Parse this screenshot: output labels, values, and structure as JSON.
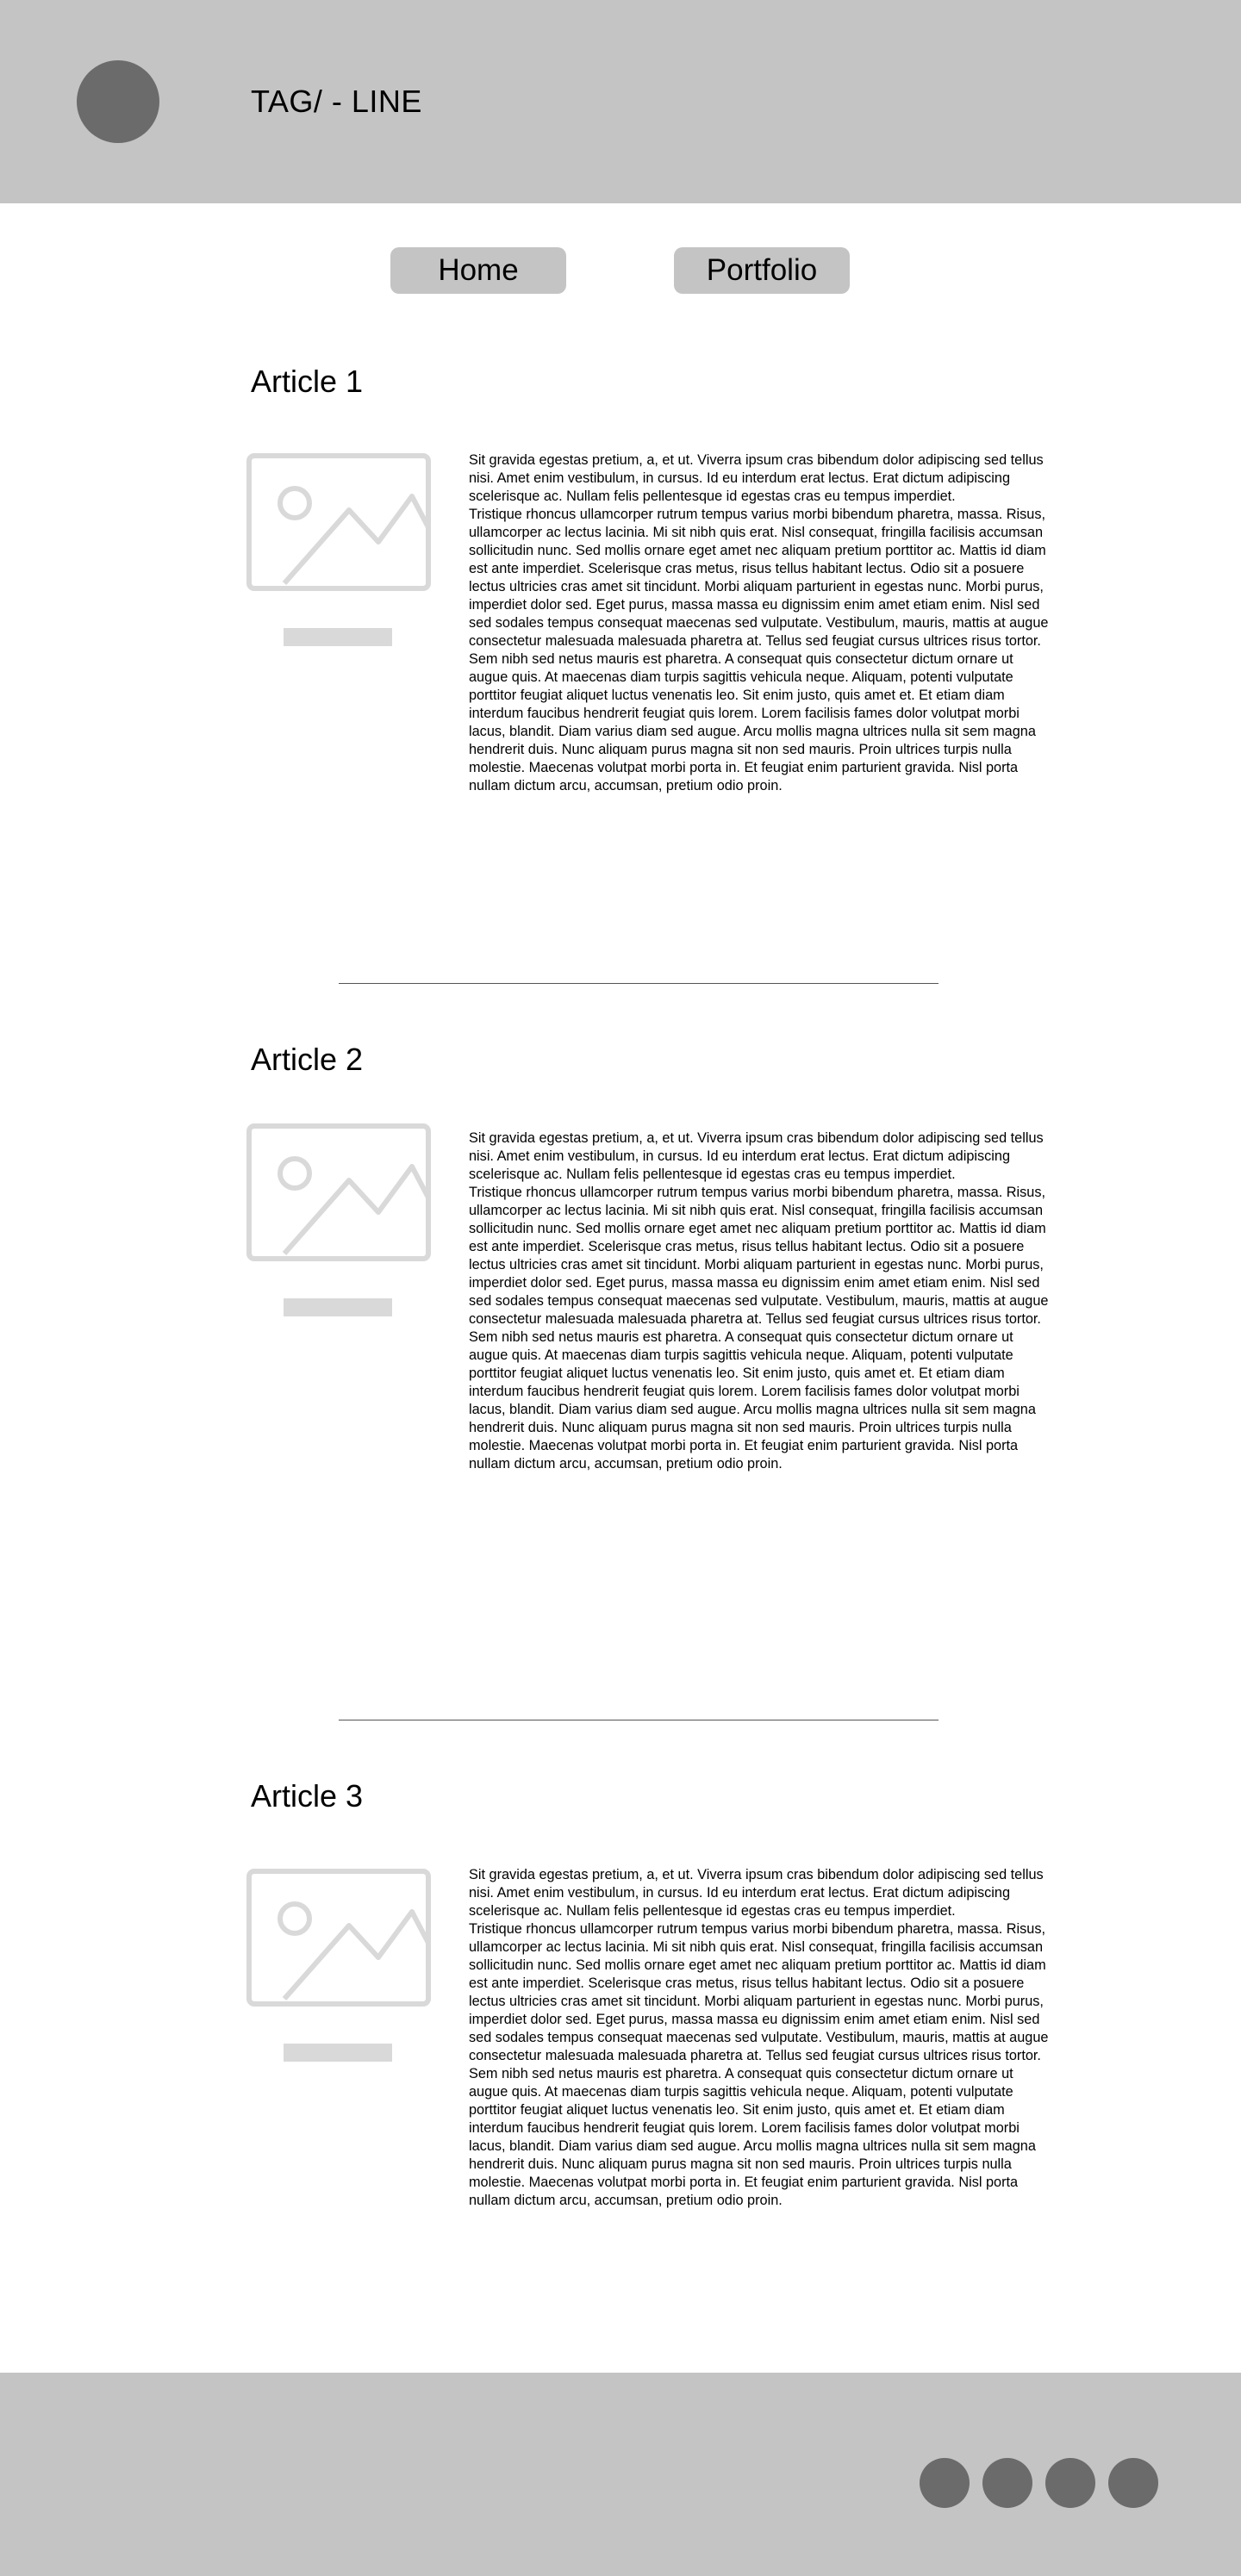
{
  "header": {
    "tagline": "TAG/ - LINE",
    "logo_icon": "circle-logo"
  },
  "nav": {
    "home_label": "Home",
    "portfolio_label": "Portfolio"
  },
  "articles": [
    {
      "title": "Article 1",
      "image_icon": "image-placeholder-icon",
      "paragraphs": [
        "Sit gravida egestas pretium, a, et ut. Viverra ipsum cras bibendum dolor adipiscing sed tellus nisi. Amet enim vestibulum, in cursus. Id eu interdum erat lectus. Erat dictum adipiscing scelerisque ac. Nullam felis pellentesque id egestas cras eu tempus imperdiet.",
        "Tristique rhoncus ullamcorper rutrum tempus varius morbi bibendum pharetra, massa. Risus, ullamcorper ac lectus lacinia. Mi sit nibh quis erat. Nisl consequat, fringilla facilisis accumsan sollicitudin nunc. Sed mollis ornare eget amet nec aliquam pretium porttitor ac. Mattis id diam est ante imperdiet. Scelerisque cras metus, risus tellus habitant lectus. Odio sit a posuere lectus ultricies cras amet sit tincidunt. Morbi aliquam parturient in egestas nunc. Morbi purus, imperdiet dolor sed. Eget purus, massa massa eu dignissim enim amet etiam enim. Nisl sed sed sodales tempus consequat maecenas sed vulputate. Vestibulum, mauris, mattis at augue consectetur malesuada malesuada pharetra at. Tellus sed feugiat cursus ultrices risus tortor.",
        "Sem nibh sed netus mauris est pharetra. A consequat quis consectetur dictum ornare ut augue quis. At maecenas diam turpis sagittis vehicula neque. Aliquam, potenti vulputate porttitor feugiat aliquet luctus venenatis leo. Sit enim justo, quis amet et. Et etiam diam interdum faucibus hendrerit feugiat quis lorem. Lorem facilisis fames dolor volutpat morbi lacus, blandit. Diam varius diam sed augue. Arcu mollis magna ultrices nulla sit sem magna hendrerit duis. Nunc aliquam purus magna sit non sed mauris. Proin ultrices turpis nulla molestie. Maecenas volutpat morbi porta in. Et feugiat enim parturient gravida. Nisl porta nullam dictum arcu, accumsan, pretium odio proin."
      ]
    },
    {
      "title": "Article 2",
      "image_icon": "image-placeholder-icon",
      "paragraphs": [
        "Sit gravida egestas pretium, a, et ut. Viverra ipsum cras bibendum dolor adipiscing sed tellus nisi. Amet enim vestibulum, in cursus. Id eu interdum erat lectus. Erat dictum adipiscing scelerisque ac. Nullam felis pellentesque id egestas cras eu tempus imperdiet.",
        "Tristique rhoncus ullamcorper rutrum tempus varius morbi bibendum pharetra, massa. Risus, ullamcorper ac lectus lacinia. Mi sit nibh quis erat. Nisl consequat, fringilla facilisis accumsan sollicitudin nunc. Sed mollis ornare eget amet nec aliquam pretium porttitor ac. Mattis id diam est ante imperdiet. Scelerisque cras metus, risus tellus habitant lectus. Odio sit a posuere lectus ultricies cras amet sit tincidunt. Morbi aliquam parturient in egestas nunc. Morbi purus, imperdiet dolor sed. Eget purus, massa massa eu dignissim enim amet etiam enim. Nisl sed sed sodales tempus consequat maecenas sed vulputate. Vestibulum, mauris, mattis at augue consectetur malesuada malesuada pharetra at. Tellus sed feugiat cursus ultrices risus tortor.",
        "Sem nibh sed netus mauris est pharetra. A consequat quis consectetur dictum ornare ut augue quis. At maecenas diam turpis sagittis vehicula neque. Aliquam, potenti vulputate porttitor feugiat aliquet luctus venenatis leo. Sit enim justo, quis amet et. Et etiam diam interdum faucibus hendrerit feugiat quis lorem. Lorem facilisis fames dolor volutpat morbi lacus, blandit. Diam varius diam sed augue. Arcu mollis magna ultrices nulla sit sem magna hendrerit duis. Nunc aliquam purus magna sit non sed mauris. Proin ultrices turpis nulla molestie. Maecenas volutpat morbi porta in. Et feugiat enim parturient gravida. Nisl porta nullam dictum arcu, accumsan, pretium odio proin."
      ]
    },
    {
      "title": "Article 3",
      "image_icon": "image-placeholder-icon",
      "paragraphs": [
        "Sit gravida egestas pretium, a, et ut. Viverra ipsum cras bibendum dolor adipiscing sed tellus nisi. Amet enim vestibulum, in cursus. Id eu interdum erat lectus. Erat dictum adipiscing scelerisque ac. Nullam felis pellentesque id egestas cras eu tempus imperdiet.",
        "Tristique rhoncus ullamcorper rutrum tempus varius morbi bibendum pharetra, massa. Risus, ullamcorper ac lectus lacinia. Mi sit nibh quis erat. Nisl consequat, fringilla facilisis accumsan sollicitudin nunc. Sed mollis ornare eget amet nec aliquam pretium porttitor ac. Mattis id diam est ante imperdiet. Scelerisque cras metus, risus tellus habitant lectus. Odio sit a posuere lectus ultricies cras amet sit tincidunt. Morbi aliquam parturient in egestas nunc. Morbi purus, imperdiet dolor sed. Eget purus, massa massa eu dignissim enim amet etiam enim. Nisl sed sed sodales tempus consequat maecenas sed vulputate. Vestibulum, mauris, mattis at augue consectetur malesuada malesuada pharetra at. Tellus sed feugiat cursus ultrices risus tortor.",
        "Sem nibh sed netus mauris est pharetra. A consequat quis consectetur dictum ornare ut augue quis. At maecenas diam turpis sagittis vehicula neque. Aliquam, potenti vulputate porttitor feugiat aliquet luctus venenatis leo. Sit enim justo, quis amet et. Et etiam diam interdum faucibus hendrerit feugiat quis lorem. Lorem facilisis fames dolor volutpat morbi lacus, blandit. Diam varius diam sed augue. Arcu mollis magna ultrices nulla sit sem magna hendrerit duis. Nunc aliquam purus magna sit non sed mauris. Proin ultrices turpis nulla molestie. Maecenas volutpat morbi porta in. Et feugiat enim parturient gravida. Nisl porta nullam dictum arcu, accumsan, pretium odio proin."
      ]
    }
  ],
  "footer": {
    "social_icons": [
      "social-icon",
      "social-icon",
      "social-icon",
      "social-icon"
    ]
  },
  "colors": {
    "header_bg": "#c4c4c4",
    "footer_bg": "#c4c4c4",
    "button_bg": "#c4c4c4",
    "dark_circle": "#6b6b6b",
    "placeholder": "#d9d9d9",
    "divider": "#555555"
  }
}
